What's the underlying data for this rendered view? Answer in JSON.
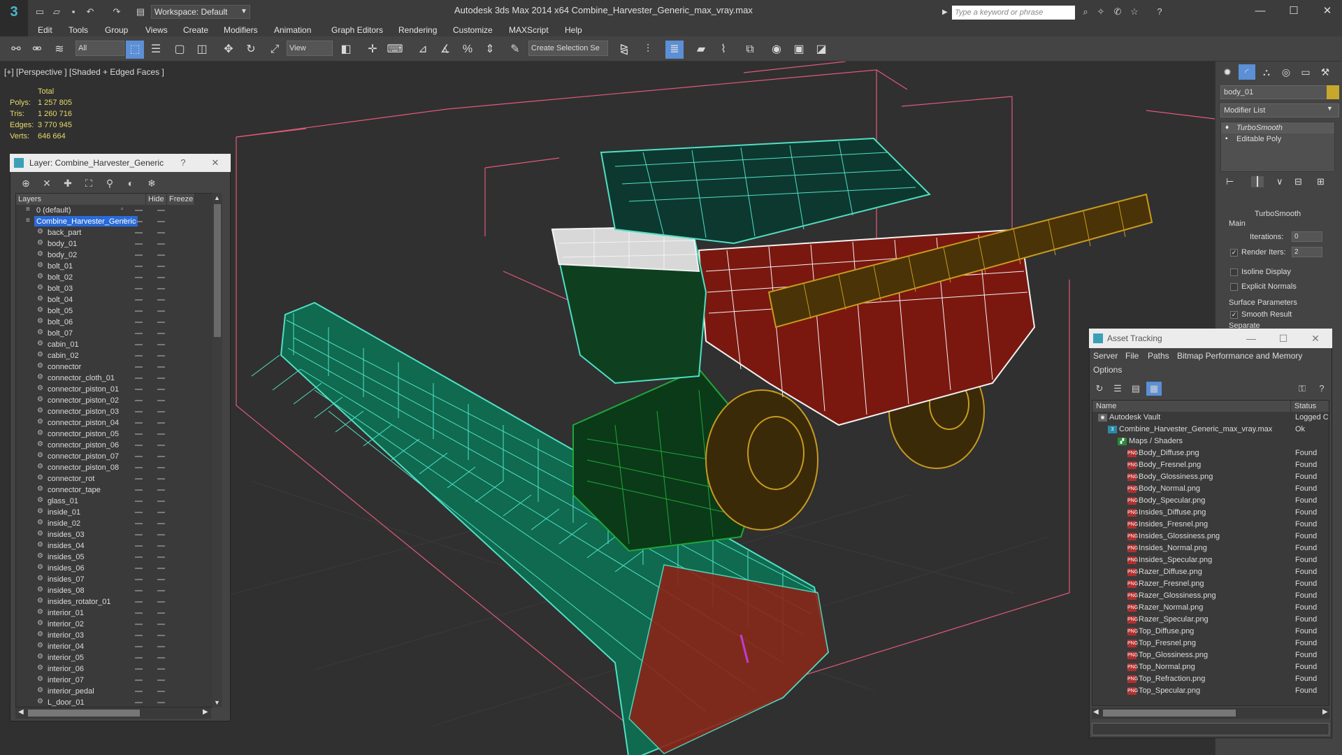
{
  "titlebar": {
    "app_title": "Autodesk 3ds Max  2014 x64      Combine_Harvester_Generic_max_vray.max",
    "workspace_label": "Workspace: Default",
    "search_placeholder": "Type a keyword or phrase"
  },
  "menu": [
    "Edit",
    "Tools",
    "Group",
    "Views",
    "Create",
    "Modifiers",
    "Animation",
    "Graph Editors",
    "Rendering",
    "Customize",
    "MAXScript",
    "Help"
  ],
  "toolbar": {
    "filter_value": "All",
    "view_value": "View",
    "selection_set": "Create Selection Se"
  },
  "viewport": {
    "label": "[+] [Perspective ] [Shaded + Edged Faces ]",
    "stats": {
      "header": "Total",
      "polys_label": "Polys:",
      "polys_value": "1 257 805",
      "tris_label": "Tris:",
      "tris_value": "1 260 716",
      "edges_label": "Edges:",
      "edges_value": "3 770 945",
      "verts_label": "Verts:",
      "verts_value": "646 664"
    }
  },
  "command_panel": {
    "object_name": "body_01",
    "object_color": "#c8a82c",
    "modifier_list_label": "Modifier List",
    "stack": [
      "TurboSmooth",
      "Editable Poly"
    ],
    "turbosmooth": {
      "title": "TurboSmooth",
      "main_label": "Main",
      "iterations_label": "Iterations:",
      "iterations_value": "0",
      "render_iters_label": "Render Iters:",
      "render_iters_value": "2",
      "render_iters_checked": true,
      "isoline_label": "Isoline Display",
      "explicit_normals_label": "Explicit Normals",
      "surface_params_label": "Surface Parameters",
      "smooth_result_label": "Smooth Result",
      "smooth_result_checked": true,
      "separate_label": "Separate"
    }
  },
  "layer_panel": {
    "title": "Layer: Combine_Harvester_Generic",
    "col_layers": "Layers",
    "col_hide": "Hide",
    "col_freeze": "Freeze",
    "layers": [
      {
        "name": "0 (default)",
        "level": 0
      },
      {
        "name": "Combine_Harvester_Generic",
        "level": 0,
        "selected": true
      },
      {
        "name": "back_part",
        "level": 1
      },
      {
        "name": "body_01",
        "level": 1
      },
      {
        "name": "body_02",
        "level": 1
      },
      {
        "name": "bolt_01",
        "level": 1
      },
      {
        "name": "bolt_02",
        "level": 1
      },
      {
        "name": "bolt_03",
        "level": 1
      },
      {
        "name": "bolt_04",
        "level": 1
      },
      {
        "name": "bolt_05",
        "level": 1
      },
      {
        "name": "bolt_06",
        "level": 1
      },
      {
        "name": "bolt_07",
        "level": 1
      },
      {
        "name": "cabin_01",
        "level": 1
      },
      {
        "name": "cabin_02",
        "level": 1
      },
      {
        "name": "connector",
        "level": 1
      },
      {
        "name": "connector_cloth_01",
        "level": 1
      },
      {
        "name": "connector_piston_01",
        "level": 1
      },
      {
        "name": "connector_piston_02",
        "level": 1
      },
      {
        "name": "connector_piston_03",
        "level": 1
      },
      {
        "name": "connector_piston_04",
        "level": 1
      },
      {
        "name": "connector_piston_05",
        "level": 1
      },
      {
        "name": "connector_piston_06",
        "level": 1
      },
      {
        "name": "connector_piston_07",
        "level": 1
      },
      {
        "name": "connector_piston_08",
        "level": 1
      },
      {
        "name": "connector_rot",
        "level": 1
      },
      {
        "name": "connector_tape",
        "level": 1
      },
      {
        "name": "glass_01",
        "level": 1
      },
      {
        "name": "inside_01",
        "level": 1
      },
      {
        "name": "inside_02",
        "level": 1
      },
      {
        "name": "insides_03",
        "level": 1
      },
      {
        "name": "insides_04",
        "level": 1
      },
      {
        "name": "insides_05",
        "level": 1
      },
      {
        "name": "insides_06",
        "level": 1
      },
      {
        "name": "insides_07",
        "level": 1
      },
      {
        "name": "insides_08",
        "level": 1
      },
      {
        "name": "insides_rotator_01",
        "level": 1
      },
      {
        "name": "interior_01",
        "level": 1
      },
      {
        "name": "interior_02",
        "level": 1
      },
      {
        "name": "interior_03",
        "level": 1
      },
      {
        "name": "interior_04",
        "level": 1
      },
      {
        "name": "interior_05",
        "level": 1
      },
      {
        "name": "interior_06",
        "level": 1
      },
      {
        "name": "interior_07",
        "level": 1
      },
      {
        "name": "interior_pedal",
        "level": 1
      },
      {
        "name": "L_door_01",
        "level": 1
      }
    ]
  },
  "asset_panel": {
    "title": "Asset Tracking",
    "menu": [
      "Server",
      "File",
      "Paths",
      "Bitmap Performance and Memory",
      "Options"
    ],
    "col_name": "Name",
    "col_status": "Status",
    "rows": [
      {
        "name": "Autodesk Vault",
        "status": "Logged C",
        "level": 0,
        "icon": "vault"
      },
      {
        "name": "Combine_Harvester_Generic_max_vray.max",
        "status": "Ok",
        "level": 1,
        "icon": "max"
      },
      {
        "name": "Maps / Shaders",
        "status": "",
        "level": 2,
        "icon": "maps"
      },
      {
        "name": "Body_Diffuse.png",
        "status": "Found",
        "level": 3,
        "icon": "png"
      },
      {
        "name": "Body_Fresnel.png",
        "status": "Found",
        "level": 3,
        "icon": "png"
      },
      {
        "name": "Body_Glossiness.png",
        "status": "Found",
        "level": 3,
        "icon": "png"
      },
      {
        "name": "Body_Normal.png",
        "status": "Found",
        "level": 3,
        "icon": "png"
      },
      {
        "name": "Body_Specular.png",
        "status": "Found",
        "level": 3,
        "icon": "png"
      },
      {
        "name": "Insides_Diffuse.png",
        "status": "Found",
        "level": 3,
        "icon": "png"
      },
      {
        "name": "Insides_Fresnel.png",
        "status": "Found",
        "level": 3,
        "icon": "png"
      },
      {
        "name": "Insides_Glossiness.png",
        "status": "Found",
        "level": 3,
        "icon": "png"
      },
      {
        "name": "Insides_Normal.png",
        "status": "Found",
        "level": 3,
        "icon": "png"
      },
      {
        "name": "Insides_Specular.png",
        "status": "Found",
        "level": 3,
        "icon": "png"
      },
      {
        "name": "Razer_Diffuse.png",
        "status": "Found",
        "level": 3,
        "icon": "png"
      },
      {
        "name": "Razer_Fresnel.png",
        "status": "Found",
        "level": 3,
        "icon": "png"
      },
      {
        "name": "Razer_Glossiness.png",
        "status": "Found",
        "level": 3,
        "icon": "png"
      },
      {
        "name": "Razer_Normal.png",
        "status": "Found",
        "level": 3,
        "icon": "png"
      },
      {
        "name": "Razer_Specular.png",
        "status": "Found",
        "level": 3,
        "icon": "png"
      },
      {
        "name": "Top_Diffuse.png",
        "status": "Found",
        "level": 3,
        "icon": "png"
      },
      {
        "name": "Top_Fresnel.png",
        "status": "Found",
        "level": 3,
        "icon": "png"
      },
      {
        "name": "Top_Glossiness.png",
        "status": "Found",
        "level": 3,
        "icon": "png"
      },
      {
        "name": "Top_Normal.png",
        "status": "Found",
        "level": 3,
        "icon": "png"
      },
      {
        "name": "Top_Refraction.png",
        "status": "Found",
        "level": 3,
        "icon": "png"
      },
      {
        "name": "Top_Specular.png",
        "status": "Found",
        "level": 3,
        "icon": "png"
      }
    ]
  },
  "colors": {
    "wire_cyan": "#4fe0c4",
    "wire_white": "#f2f2f2",
    "wire_green": "#1fa83a",
    "wire_yellow": "#c89a1e",
    "wire_red": "#b42a1e",
    "selection_blue": "#2a6ad8",
    "bbox_pink": "#e05a7a",
    "stats_yellow": "#e8d96a"
  }
}
